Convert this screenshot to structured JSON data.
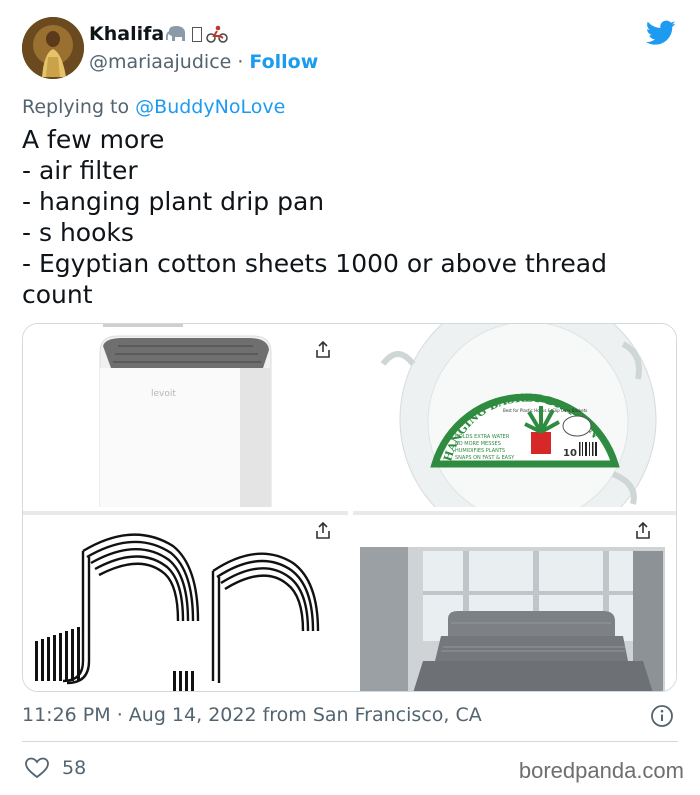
{
  "author": {
    "display_name": "Khalifa",
    "handle": "@mariaajudice",
    "separator": "·",
    "follow_label": "Follow"
  },
  "reply": {
    "prefix": "Replying to",
    "mention": "@BuddyNoLove"
  },
  "tweet": {
    "lines": [
      "A few more",
      "- air filter",
      "- hanging plant drip pan",
      "- s hooks",
      "- Egyptian cotton sheets 1000 or above thread count"
    ]
  },
  "media": {
    "drip_pan_label_top": "HANGING BASKET DRIP PAN",
    "drip_pan_sub": "Best for Plastic Hooks & Clip Over Baskets",
    "drip_pan_bullets": [
      "HOLDS EXTRA WATER",
      "NO MORE MESSES",
      "HUMIDIFIES PLANTS",
      "SNAPS ON FAST & EASY"
    ],
    "drip_pan_count": "10",
    "purifier_brand": "levoit"
  },
  "footer": {
    "time": "11:26 PM",
    "date": "Aug 14, 2022",
    "source": "from San Francisco, CA",
    "likes": "58",
    "watermark": "boredpanda.com"
  },
  "colors": {
    "accent": "#1d9bf0",
    "text": "#0f1419",
    "muted": "#536471",
    "border": "#cfd9de"
  }
}
